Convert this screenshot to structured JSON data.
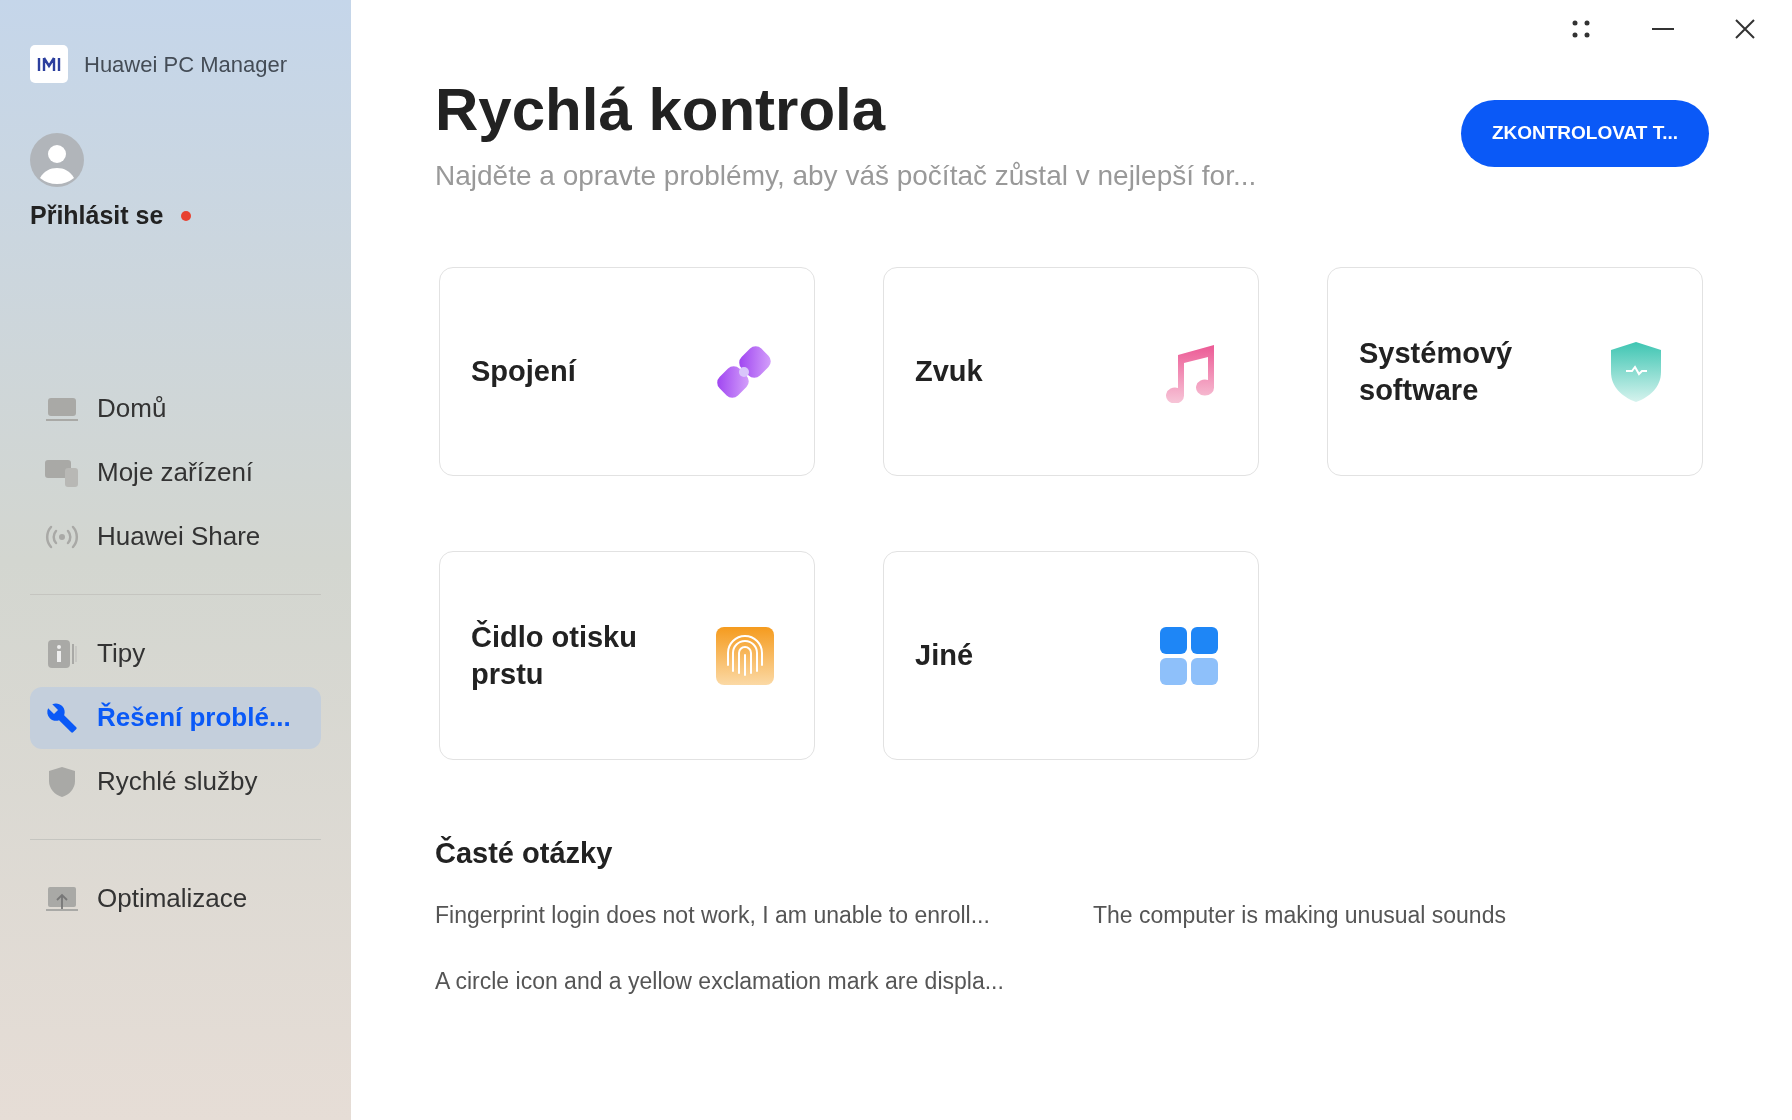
{
  "app": {
    "name": "Huawei PC Manager"
  },
  "account": {
    "label": "Přihlásit se",
    "notification": true
  },
  "nav_groups": [
    [
      {
        "label": "Domů",
        "kind": "laptop",
        "selected": false
      },
      {
        "label": "Moje zařízení",
        "kind": "devices",
        "selected": false
      },
      {
        "label": "Huawei Share",
        "kind": "broadcast",
        "selected": false
      }
    ],
    [
      {
        "label": "Tipy",
        "kind": "info",
        "selected": false
      },
      {
        "label": "Řešení problé...",
        "kind": "wrench",
        "selected": true
      },
      {
        "label": "Rychlé služby",
        "kind": "shield",
        "selected": false
      }
    ],
    [
      {
        "label": "Optimalizace",
        "kind": "upload",
        "selected": false
      }
    ]
  ],
  "header": {
    "title": "Rychlá kontrola",
    "subtitle": "Najděte a opravte problémy, aby váš počítač zůstal v nejlepší for...",
    "button": "ZKONTROLOVAT T..."
  },
  "cards": [
    {
      "label": "Spojení",
      "kind": "link"
    },
    {
      "label": "Zvuk",
      "kind": "music"
    },
    {
      "label": "Systémový software",
      "kind": "shield"
    },
    {
      "label": "Čidlo otisku prstu",
      "kind": "fingerprint"
    },
    {
      "label": "Jiné",
      "kind": "grid"
    }
  ],
  "faq": {
    "title": "Časté otázky",
    "items": [
      "Fingerprint login does not work, I am unable to enroll...",
      "The computer is making unusual sounds",
      "A circle icon and a yellow exclamation mark are displa..."
    ]
  }
}
